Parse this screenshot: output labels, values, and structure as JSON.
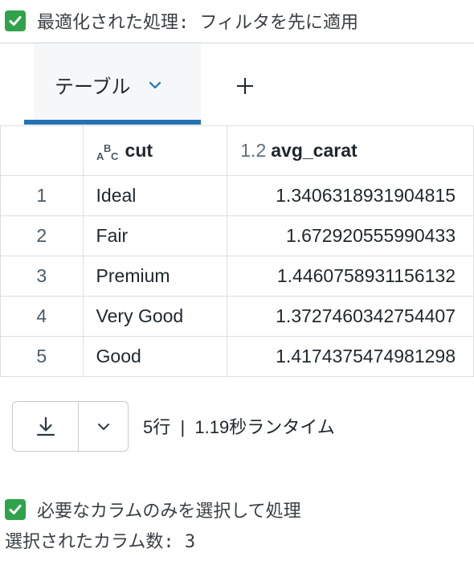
{
  "top_status": {
    "text": "最適化された処理: フィルタを先に適用"
  },
  "tabs": {
    "active_label": "テーブル"
  },
  "table": {
    "columns": [
      {
        "type_icon": "abc-icon",
        "label": "cut"
      },
      {
        "type_badge": "1.2",
        "label": "avg_carat"
      }
    ],
    "rows": [
      {
        "index": "1",
        "cut": "Ideal",
        "avg_carat": "1.3406318931904815"
      },
      {
        "index": "2",
        "cut": "Fair",
        "avg_carat": "1.672920555990433"
      },
      {
        "index": "3",
        "cut": "Premium",
        "avg_carat": "1.4460758931156132"
      },
      {
        "index": "4",
        "cut": "Very Good",
        "avg_carat": "1.3727460342754407"
      },
      {
        "index": "5",
        "cut": "Good",
        "avg_carat": "1.4174375474981298"
      }
    ]
  },
  "footer": {
    "run_info": "5行  |  1.19秒ランタイム"
  },
  "bottom_status": {
    "text": "必要なカラムのみを選択して処理",
    "selected_columns": "選択されたカラム数: 3"
  },
  "colors": {
    "check_green": "#31a24c",
    "tab_accent": "#2272b4"
  }
}
